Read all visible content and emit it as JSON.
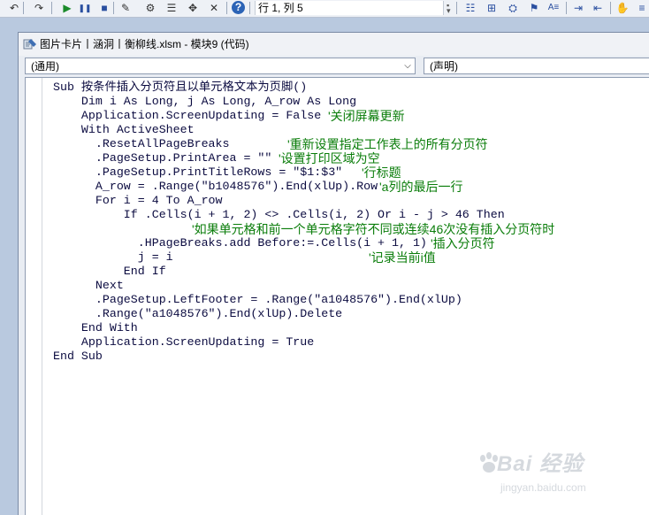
{
  "toolbar": {
    "buttons": [
      {
        "icon": "undo-icon",
        "glyph": "↶"
      },
      {
        "icon": "redo-icon",
        "glyph": "↷"
      },
      {
        "icon": "run-icon",
        "glyph": "▶"
      },
      {
        "icon": "pause-icon",
        "glyph": "❚❚"
      },
      {
        "icon": "stop-icon",
        "glyph": "■"
      },
      {
        "icon": "design-mode-icon",
        "glyph": "✎"
      },
      {
        "icon": "project-explorer-icon",
        "glyph": "⚙"
      },
      {
        "icon": "properties-icon",
        "glyph": "☰"
      },
      {
        "icon": "object-browser-icon",
        "glyph": "✥"
      },
      {
        "icon": "toolbox-icon",
        "glyph": "✕"
      },
      {
        "icon": "help-icon",
        "glyph": "?"
      }
    ],
    "position_label": "行 1, 列 5",
    "right_buttons": [
      {
        "icon": "list-properties-icon",
        "glyph": "☷"
      },
      {
        "icon": "list-constants-icon",
        "glyph": "⊞"
      },
      {
        "icon": "quick-info-icon",
        "glyph": "⛭"
      },
      {
        "icon": "parameter-info-icon",
        "glyph": "⚑"
      },
      {
        "icon": "complete-word-icon",
        "glyph": "A≡"
      },
      {
        "icon": "indent-icon",
        "glyph": "⇥"
      },
      {
        "icon": "outdent-icon",
        "glyph": "⇤"
      },
      {
        "icon": "hand-icon",
        "glyph": "✋"
      },
      {
        "icon": "comment-block-icon",
        "glyph": "≡"
      }
    ]
  },
  "window": {
    "title": "图片卡片丨涵洞丨衡柳线.xlsm - 模块9 (代码)"
  },
  "combos": {
    "object": "(通用)",
    "procedure": "(声明)"
  },
  "code": {
    "lines": [
      "Sub 按条件插入分页符且以单元格文本为页脚()",
      "    Dim i As Long, j As Long, A_row As Long",
      "    Application.ScreenUpdating = False",
      "    With ActiveSheet",
      "      .ResetAllPageBreaks",
      "      .PageSetup.PrintArea = \"\"",
      "      .PageSetup.PrintTitleRows = \"$1:$3\"",
      "      A_row = .Range(\"b1048576\").End(xlUp).Row",
      "      For i = 4 To A_row",
      "          If .Cells(i + 1, 2) <> .Cells(i, 2) Or i - j > 46 Then",
      "",
      "            .HPageBreaks.add Before:=.Cells(i + 1, 1)",
      "            j = i",
      "          End If",
      "      Next",
      "      .PageSetup.LeftFooter = .Range(\"a1048576\").End(xlUp)",
      "      .Range(\"a1048576\").End(xlUp).Delete",
      "    End With",
      "    Application.ScreenUpdating = True",
      "End Sub"
    ],
    "comments": [
      {
        "line": 2,
        "text": "'关闭屏幕更新"
      },
      {
        "line": 4,
        "text": "'重新设置指定工作表上的所有分页符"
      },
      {
        "line": 5,
        "text": "'设置打印区域为空"
      },
      {
        "line": 6,
        "text": "'行标题"
      },
      {
        "line": 7,
        "text": "'a列的最后一行"
      },
      {
        "line": 10,
        "text": "'如果单元格和前一个单元格字符不同或连续46次没有插入分页符时"
      },
      {
        "line": 11,
        "text": "'插入分页符"
      },
      {
        "line": 12,
        "text": "'记录当前i值"
      }
    ]
  },
  "watermark": {
    "main": "Bai 经验",
    "sub": "jingyan.baidu.com"
  },
  "colors": {
    "code_text": "#0b0b40",
    "comment": "#0a7d0a",
    "background": "#b9c9df"
  }
}
